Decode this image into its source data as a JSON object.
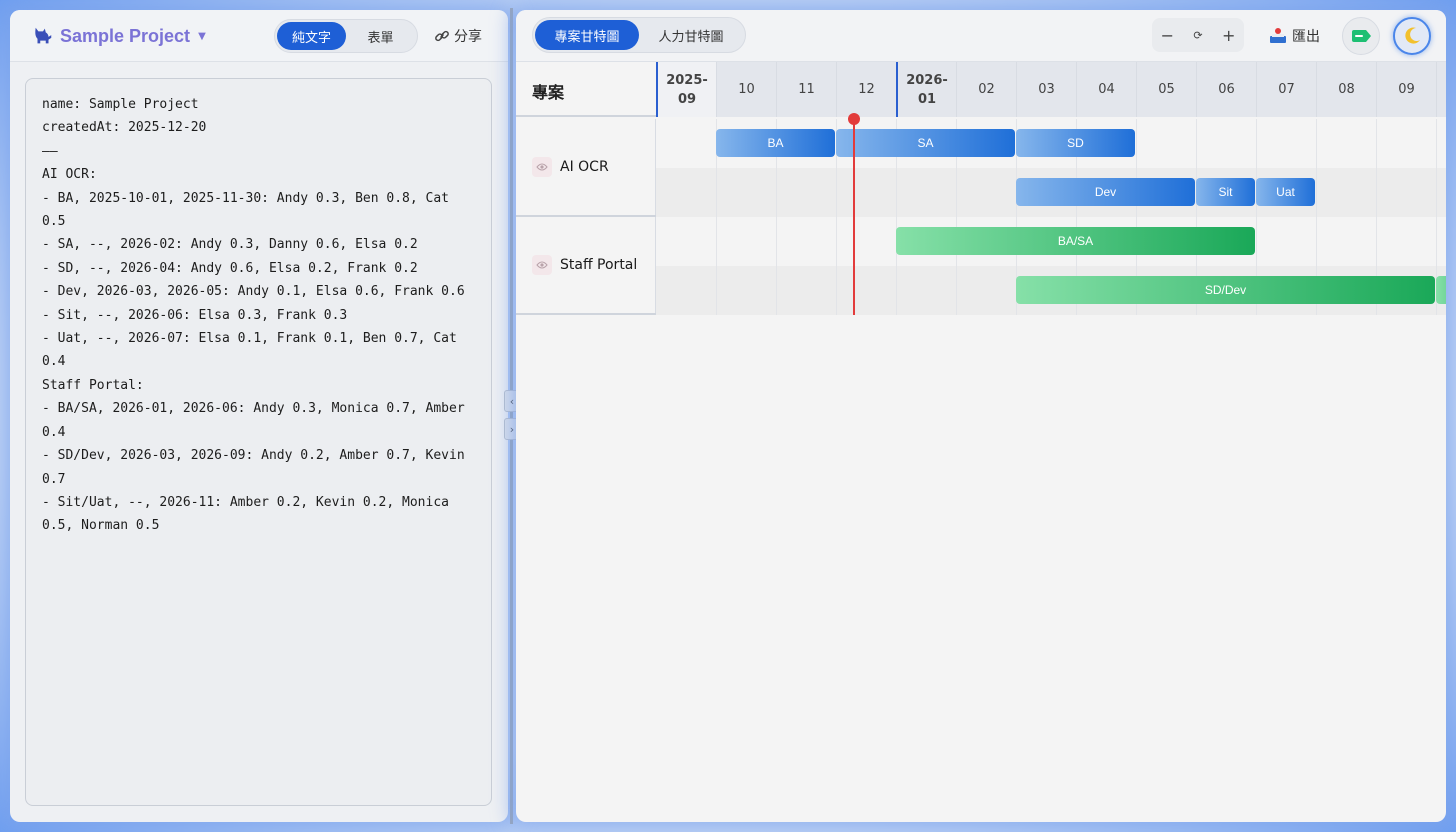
{
  "left": {
    "project_title": "Sample Project",
    "view_tabs": [
      {
        "label": "純文字",
        "active": true
      },
      {
        "label": "表單",
        "active": false
      }
    ],
    "share_label": "分享",
    "editor_text": "name: Sample Project\ncreatedAt: 2025-12-20\n——\nAI OCR:\n- BA, 2025-10-01, 2025-11-30: Andy 0.3, Ben 0.8, Cat 0.5\n- SA, --, 2026-02: Andy 0.3, Danny 0.6, Elsa 0.2\n- SD, --, 2026-04: Andy 0.6, Elsa 0.2, Frank 0.2\n- Dev, 2026-03, 2026-05: Andy 0.1, Elsa 0.6, Frank 0.6\n- Sit, --, 2026-06: Elsa 0.3, Frank 0.3\n- Uat, --, 2026-07: Elsa 0.1, Frank 0.1, Ben 0.7, Cat 0.4\nStaff Portal:\n- BA/SA, 2026-01, 2026-06: Andy 0.3, Monica 0.7, Amber 0.4\n- SD/Dev, 2026-03, 2026-09: Andy 0.2, Amber 0.7, Kevin 0.7\n- Sit/Uat, --, 2026-11: Amber 0.2, Kevin 0.2, Monica 0.5, Norman 0.5"
  },
  "splitter": {
    "collapse_left": "‹",
    "collapse_right": "›"
  },
  "right": {
    "view_tabs": [
      {
        "label": "專案甘特圖",
        "active": true
      },
      {
        "label": "人力甘特圖",
        "active": false
      }
    ],
    "zoom": {
      "out": "−",
      "reset": "⟳",
      "in": "+"
    },
    "export_label": "匯出",
    "colors": {
      "accent": "#1e5fd6",
      "today": "#e23b3b",
      "blue_bar": "#1f6fd8",
      "green_bar": "#1aa858",
      "tag": "#1dbf73"
    },
    "gantt": {
      "project_column_label": "專案",
      "months": [
        {
          "label": "2025-\n09",
          "year_start": true
        },
        {
          "label": "10"
        },
        {
          "label": "11"
        },
        {
          "label": "12"
        },
        {
          "label": "2026-\n01",
          "year_start": true
        },
        {
          "label": "02"
        },
        {
          "label": "03"
        },
        {
          "label": "04"
        },
        {
          "label": "05"
        },
        {
          "label": "06"
        },
        {
          "label": "07"
        },
        {
          "label": "08"
        },
        {
          "label": "09"
        }
      ],
      "today_month_offset": 3.3,
      "projects": [
        {
          "name": "AI OCR",
          "color": "blue",
          "lanes": [
            [
              {
                "label": "BA",
                "start": 1,
                "end": 3
              },
              {
                "label": "SA",
                "start": 3,
                "end": 6
              },
              {
                "label": "SD",
                "start": 6,
                "end": 8
              }
            ],
            [
              {
                "label": "Dev",
                "start": 6,
                "end": 9
              },
              {
                "label": "Sit",
                "start": 9,
                "end": 10
              },
              {
                "label": "Uat",
                "start": 10,
                "end": 11
              }
            ]
          ]
        },
        {
          "name": "Staff Portal",
          "color": "green",
          "lanes": [
            [
              {
                "label": "BA/SA",
                "start": 4,
                "end": 10
              }
            ],
            [
              {
                "label": "SD/Dev",
                "start": 6,
                "end": 13
              },
              {
                "label": "",
                "start": 13,
                "end": 14
              }
            ]
          ]
        }
      ]
    }
  }
}
